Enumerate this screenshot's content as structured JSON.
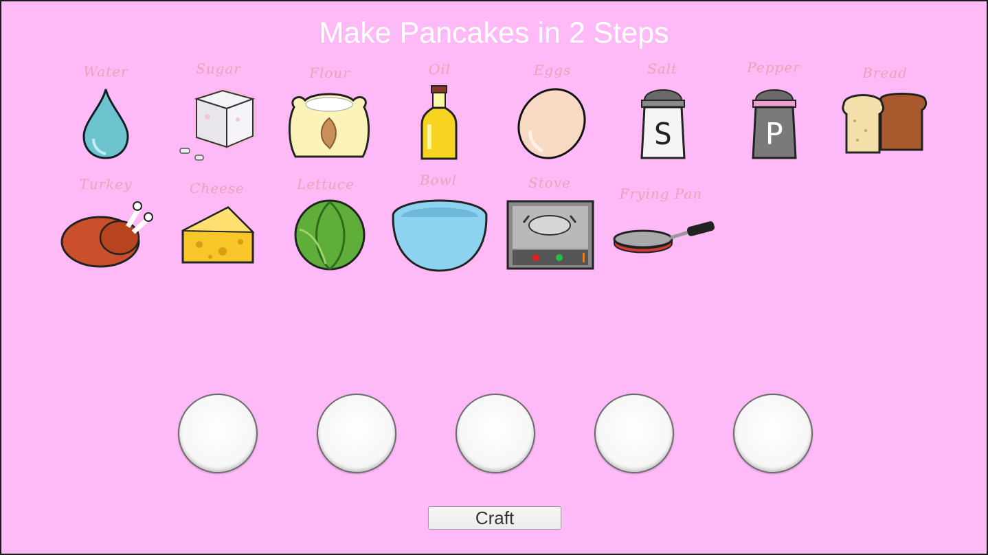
{
  "title": "Make Pancakes in 2 Steps",
  "ingredients": [
    {
      "label": "Water",
      "icon": "water-drop-icon"
    },
    {
      "label": "Sugar",
      "icon": "sugar-cube-icon"
    },
    {
      "label": "Flour",
      "icon": "flour-sack-icon"
    },
    {
      "label": "Oil",
      "icon": "oil-bottle-icon"
    },
    {
      "label": "Eggs",
      "icon": "egg-icon"
    },
    {
      "label": "Salt",
      "icon": "salt-shaker-icon"
    },
    {
      "label": "Pepper",
      "icon": "pepper-shaker-icon"
    },
    {
      "label": "Bread",
      "icon": "bread-loaf-icon"
    },
    {
      "label": "Turkey",
      "icon": "roast-turkey-icon"
    },
    {
      "label": "Cheese",
      "icon": "cheese-wedge-icon"
    },
    {
      "label": "Lettuce",
      "icon": "lettuce-icon"
    },
    {
      "label": "Bowl",
      "icon": "bowl-icon"
    },
    {
      "label": "Stove",
      "icon": "stove-icon"
    },
    {
      "label": "Frying Pan",
      "icon": "frying-pan-icon"
    }
  ],
  "craft_slots": [
    {
      "content": ""
    },
    {
      "content": ""
    },
    {
      "content": ""
    },
    {
      "content": ""
    },
    {
      "content": ""
    }
  ],
  "craft_button_label": "Craft",
  "colors": {
    "background": "#fdbaf6",
    "title": "#ffffff",
    "item_label": "#e9a3b3",
    "slot_fill": "#f7f7f7"
  }
}
